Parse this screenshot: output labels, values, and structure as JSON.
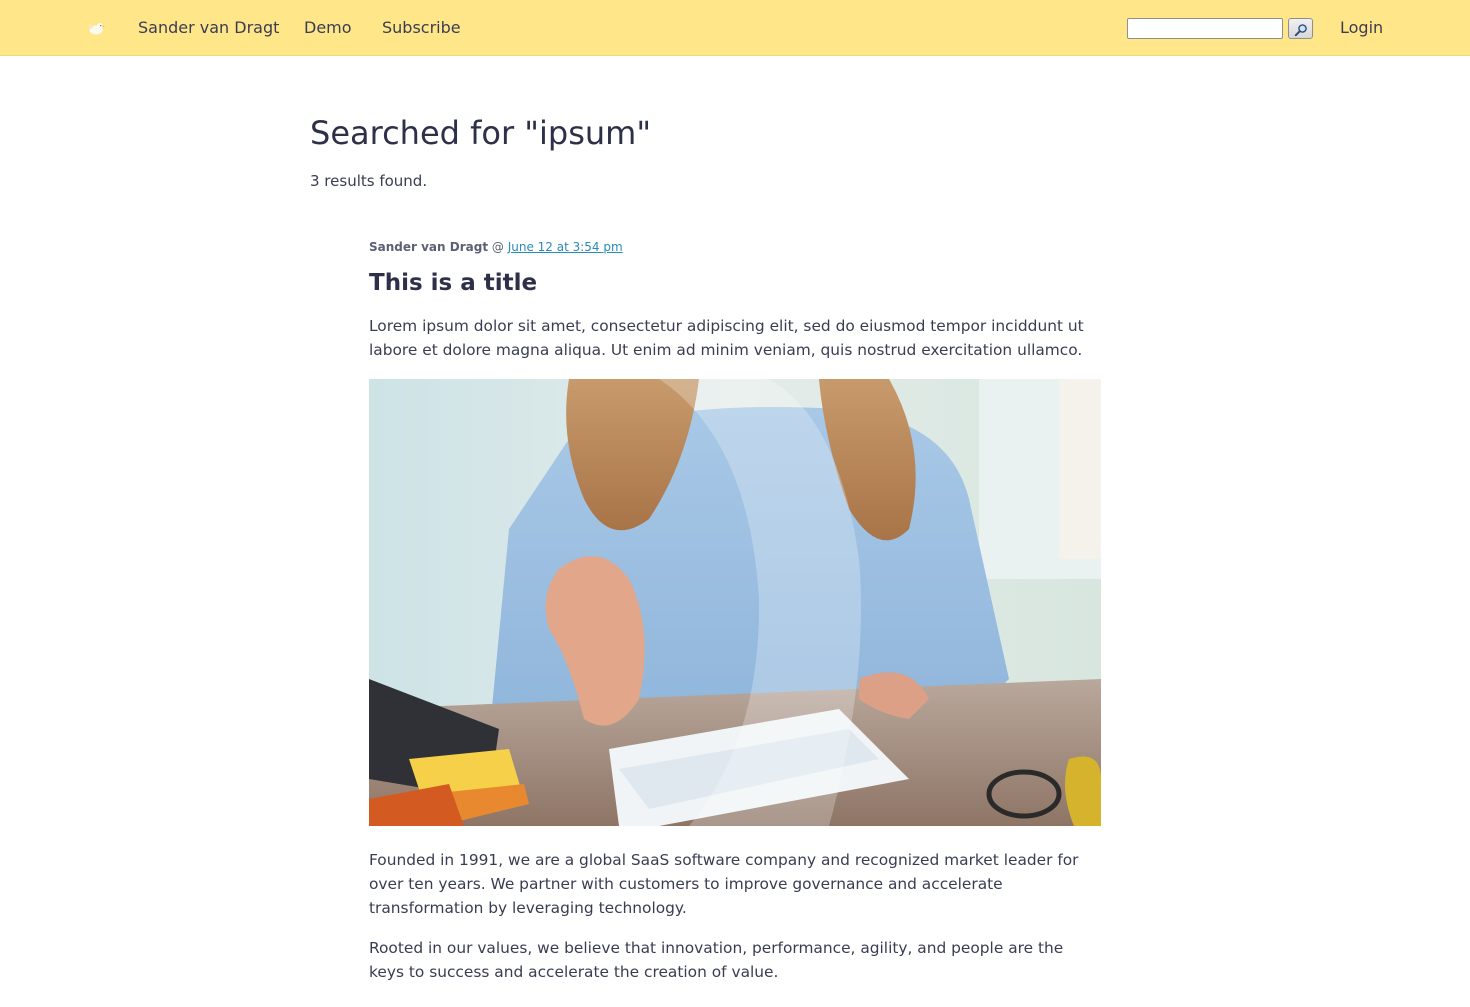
{
  "header": {
    "logo_icon": "bird-logo-icon",
    "nav": {
      "home": "Sander van Dragt",
      "demo": "Demo",
      "subscribe": "Subscribe"
    },
    "search": {
      "value": "",
      "button_icon": "magnifier-icon"
    },
    "login": "Login"
  },
  "main": {
    "title": "Searched for \"ipsum\"",
    "results_count": "3 results found.",
    "post": {
      "author": "Sander van Dragt",
      "separator": "@",
      "date": "June 12 at 3:54 pm",
      "title": "This is a title",
      "intro": "Lorem ipsum dolor sit amet, consectetur adipiscing elit, sed do eiusmod tempor inciddunt ut labore et dolore magna aliqua. Ut enim ad minim veniam, quis nostrud exercitation ullamco.",
      "image_subject": "photo-woman-handshake-office",
      "paragraph_1": "Founded in 1991, we are a global SaaS software company and recognized market leader for over ten years. We partner with customers to improve governance and accelerate transformation by leveraging technology.",
      "paragraph_2": "Rooted in our values, we believe that innovation, performance, agility, and people are the keys to success and accelerate the creation of value."
    }
  },
  "colors": {
    "header_bg": "#ffe689",
    "text": "#2d3048",
    "link": "#2a8bb7"
  }
}
